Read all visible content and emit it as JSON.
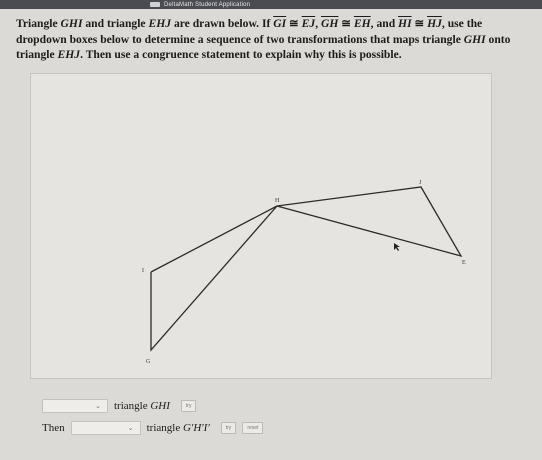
{
  "app": {
    "title": "DeltaMath Student Application"
  },
  "question": {
    "part1": "Triangle ",
    "tri1": "GHI",
    "part2": " and triangle ",
    "tri2": "EHJ",
    "part3": " are drawn below. If ",
    "seg1a": "GI",
    "cong": " ≅ ",
    "seg1b": "EJ",
    "comma": ", ",
    "seg2a": "GH",
    "seg2b": "EH",
    "and": ", and ",
    "seg3a": "HI",
    "seg3b": "HJ",
    "part4": ", use the dropdown boxes below to determine a sequence of two transformations that maps triangle ",
    "tri3": "GHI",
    "part5": " onto triangle ",
    "tri4": "EHJ",
    "part6": ". Then use a congruence statement to explain why this is possible."
  },
  "diagram": {
    "labels": {
      "G": "G",
      "H": "H",
      "I": "I",
      "J": "J",
      "E": "E"
    },
    "colors": {
      "line": "#2b2b2b",
      "label": "#333333"
    }
  },
  "controls": {
    "row1": {
      "dropdown_value": "",
      "label_prefix": "triangle ",
      "label_var": "GHI",
      "try_label": "try"
    },
    "row2": {
      "then_label": "Then",
      "dropdown_value": "",
      "label_prefix": "triangle ",
      "label_var": "G′H′I′",
      "try_label": "try",
      "reset_label": "reset"
    }
  }
}
